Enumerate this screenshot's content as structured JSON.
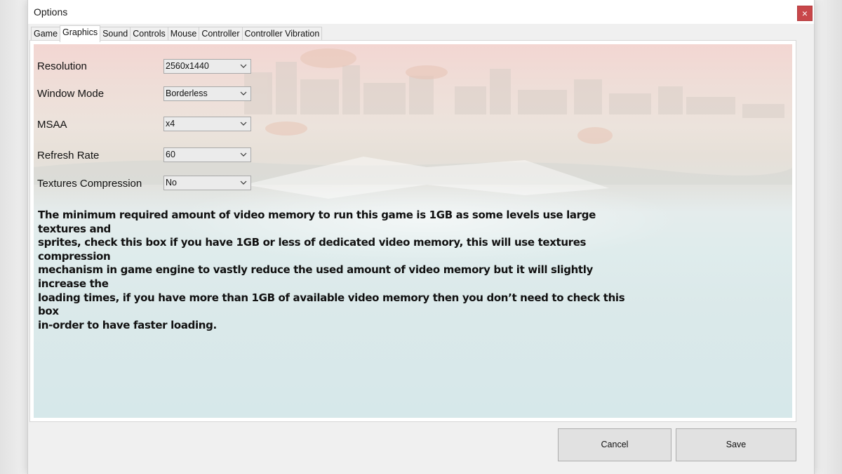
{
  "window": {
    "title": "Options",
    "close_label": "×"
  },
  "tabs": [
    {
      "label": "Game",
      "active": false
    },
    {
      "label": "Graphics",
      "active": true
    },
    {
      "label": "Sound",
      "active": false
    },
    {
      "label": "Controls",
      "active": false
    },
    {
      "label": "Mouse",
      "active": false
    },
    {
      "label": "Controller",
      "active": false
    },
    {
      "label": "Controller Vibration",
      "active": false
    }
  ],
  "settings": {
    "resolution": {
      "label": "Resolution",
      "value": "2560x1440"
    },
    "window_mode": {
      "label": "Window Mode",
      "value": "Borderless"
    },
    "msaa": {
      "label": "MSAA",
      "value": "x4"
    },
    "refresh_rate": {
      "label": "Refresh Rate",
      "value": "60"
    },
    "textures_compression": {
      "label": "Textures Compression",
      "value": "No"
    }
  },
  "description": {
    "lines": [
      "The minimum required amount of video memory to run this game is 1GB as some levels use large textures and",
      "sprites, check this box if you have 1GB or less of dedicated video memory, this will use textures compression",
      "mechanism in game engine to vastly reduce the used amount of video memory but it will slightly increase the",
      "loading times, if you have more than 1GB of available video memory then you don’t need to check this box",
      "in-order to have faster loading."
    ]
  },
  "buttons": {
    "cancel": "Cancel",
    "save": "Save"
  },
  "colors": {
    "close_button": "#c8474a",
    "panel_bg": "#ffffff",
    "window_bg": "#f0f0f0"
  }
}
